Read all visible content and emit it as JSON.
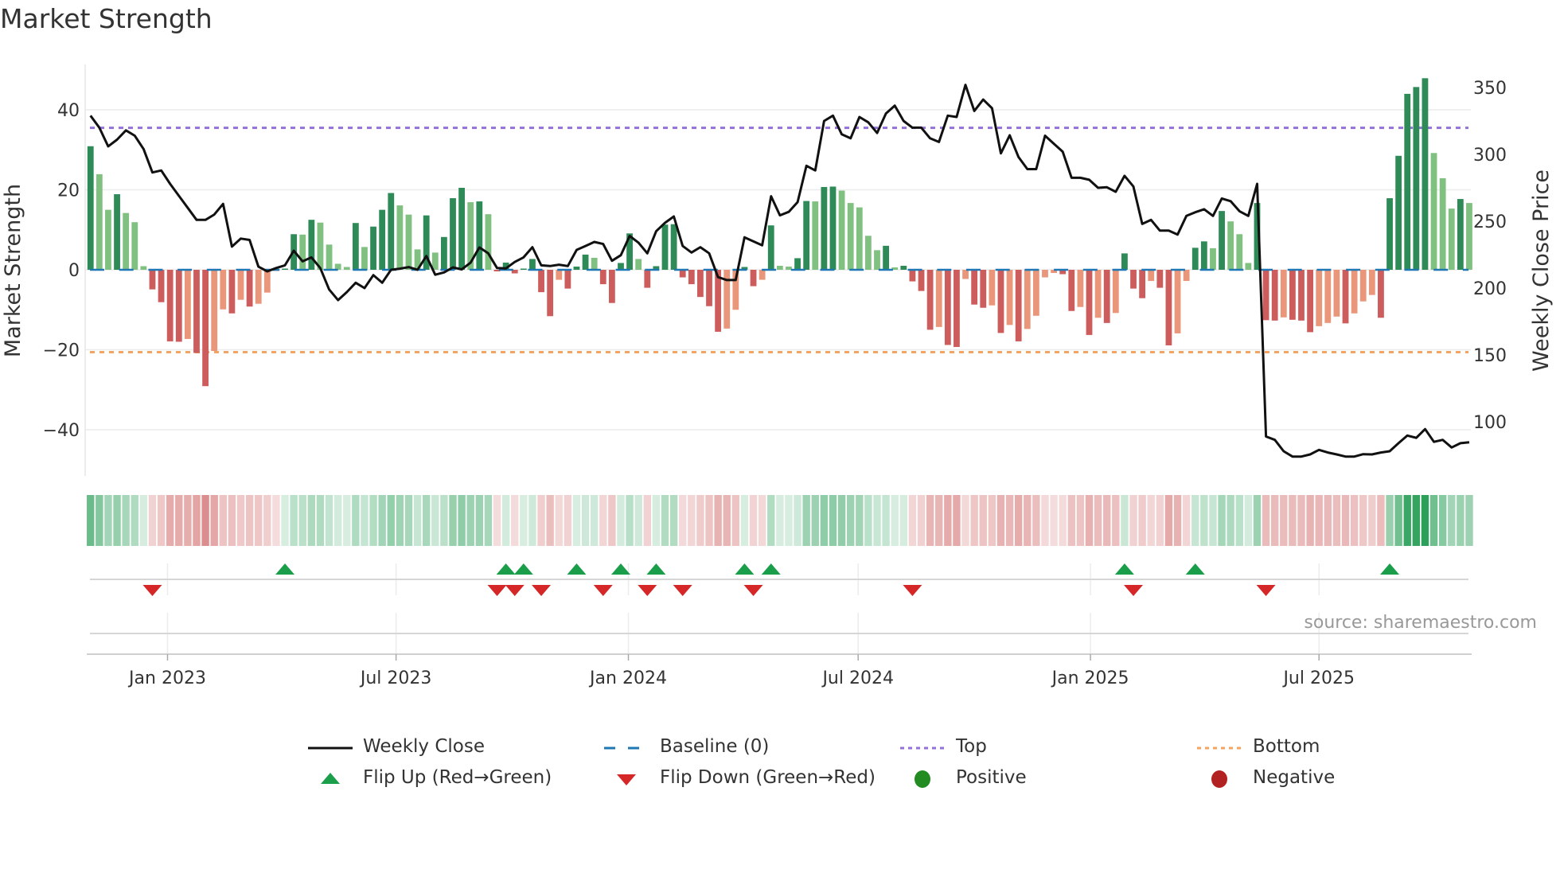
{
  "title": "Market Strength",
  "source": "source: sharemaestro.com",
  "colors": {
    "bar_up_strong": "#2e8b57",
    "bar_up_weak": "#80c080",
    "bar_down_strong": "#cd5c5c",
    "bar_down_weak": "#e9967a",
    "close_line": "#111111",
    "baseline": "#1f77b4",
    "top": "#9370db",
    "bottom": "#f4a460",
    "flip_up": "#1a9e4a",
    "flip_down": "#d62728",
    "positive": "#228b22",
    "negative": "#b22222"
  },
  "legend": [
    {
      "label": "Weekly Close",
      "icon": "solid-line"
    },
    {
      "label": "Baseline (0)",
      "icon": "dashed-line"
    },
    {
      "label": "Top",
      "icon": "dotted-line"
    },
    {
      "label": "Bottom",
      "icon": "dotted-line"
    },
    {
      "label": "Flip Up (Red→Green)",
      "icon": "triangle-up"
    },
    {
      "label": "Flip Down (Green→Red)",
      "icon": "triangle-down"
    },
    {
      "label": "Positive",
      "icon": "circle"
    },
    {
      "label": "Negative",
      "icon": "circle"
    }
  ],
  "chart_data": {
    "type": "bar+line",
    "title": "Market Strength",
    "ylabel": "Market Strength",
    "y2label": "Weekly Close Price",
    "ylim": [
      -51,
      52
    ],
    "y2lim": [
      60,
      367
    ],
    "yticks": [
      -40,
      -20,
      0,
      20,
      40
    ],
    "y2ticks": [
      100,
      150,
      200,
      250,
      300,
      350
    ],
    "xticks": [
      {
        "date": "2023-01-01",
        "label": "Jan 2023"
      },
      {
        "date": "2023-07-01",
        "label": "Jul 2023"
      },
      {
        "date": "2024-01-01",
        "label": "Jan 2024"
      },
      {
        "date": "2024-07-01",
        "label": "Jul 2024"
      },
      {
        "date": "2025-01-01",
        "label": "Jan 2025"
      },
      {
        "date": "2025-07-01",
        "label": "Jul 2025"
      }
    ],
    "grid": true,
    "legend_position": "bottom",
    "start_date": "2022-11-01",
    "interval_days": 7,
    "top_level": 35.5,
    "bottom_level": -20.6,
    "baseline": 0,
    "strength": [
      30.9,
      23.9,
      15,
      18.9,
      14.2,
      11.9,
      0.9,
      -4.9,
      -8.1,
      -17.9,
      -18,
      -17.3,
      -20.8,
      -29.1,
      -20.3,
      -9.9,
      -10.9,
      -7.5,
      -9.2,
      -8.5,
      -5.7,
      -0.3,
      0.3,
      8.9,
      8.8,
      12.5,
      11.8,
      6.3,
      1.5,
      0.7,
      11.7,
      5.7,
      10.8,
      15,
      19.2,
      16.1,
      13.8,
      5.1,
      13.6,
      4.3,
      8.2,
      17.9,
      20.5,
      16.9,
      17.1,
      13.9,
      -0.4,
      1.8,
      -0.9,
      0.3,
      2.7,
      -5.6,
      -11.6,
      -2.5,
      -4.7,
      0.8,
      3.8,
      3,
      -3.6,
      -8.3,
      1.7,
      9.1,
      2.7,
      -4.5,
      0.9,
      11.3,
      11.4,
      -1.9,
      -3.6,
      -6.8,
      -9.1,
      -15.5,
      -14.7,
      -10,
      0.7,
      -4.1,
      -2.5,
      11.1,
      1,
      0.8,
      2.9,
      17.2,
      17.1,
      20.7,
      20.8,
      19.8,
      16.7,
      15.6,
      8.5,
      4.9,
      6,
      0.6,
      1,
      -2.9,
      -5.3,
      -15,
      -14.3,
      -18.8,
      -19.3,
      -2.3,
      -8.7,
      -9.5,
      -8.9,
      -15.8,
      -13.8,
      -17.9,
      -14.8,
      -11.5,
      -1.9,
      -0.8,
      -1.1,
      -10.3,
      -9.3,
      -16.3,
      -12,
      -13.3,
      -10.8,
      4.1,
      -4.7,
      -7.1,
      -2.8,
      -4.5,
      -18.9,
      -15.9,
      -2.8,
      5.5,
      7.1,
      5.4,
      14.7,
      12.1,
      8.9,
      1.7,
      16.7,
      -12.6,
      -12.7,
      -11.9,
      -12.5,
      -12.7,
      -15.6,
      -14.1,
      -13.3,
      -11.7,
      -13.4,
      -10.9,
      -7.9,
      -6.3,
      -12,
      17.9,
      28.5,
      44,
      45.7,
      47.9,
      29.2,
      22.9,
      15.3,
      17.7,
      16.7
    ],
    "weekly_close": [
      329,
      320,
      306,
      311,
      318,
      314,
      304,
      286.5,
      288,
      278,
      269,
      260,
      251,
      251,
      255,
      263,
      231,
      237,
      236,
      216,
      212.5,
      215,
      217,
      228,
      220,
      223,
      215,
      199,
      191,
      197,
      204,
      200,
      209.7,
      204,
      213.7,
      214.5,
      215.7,
      213.7,
      224,
      210,
      211.7,
      215.5,
      214,
      219,
      230.4,
      226,
      215,
      214.7,
      219.5,
      223,
      230.6,
      217,
      216.5,
      217.5,
      216.5,
      228.6,
      231.5,
      234.5,
      233,
      220.4,
      224.6,
      239,
      234,
      226,
      242.5,
      248.8,
      253.6,
      231.5,
      226.6,
      230.6,
      226,
      208.2,
      206,
      206,
      238,
      235,
      232,
      268.7,
      254.4,
      257,
      264.3,
      291.5,
      288,
      325,
      329,
      315,
      312,
      328,
      324,
      316,
      330.6,
      336.5,
      325,
      320,
      320,
      312,
      309.3,
      329,
      328,
      352,
      332.5,
      341,
      334.5,
      300.8,
      314.3,
      298,
      289,
      289,
      314,
      308,
      302,
      282.5,
      282.5,
      281,
      275,
      275.4,
      272,
      284,
      276,
      248,
      251,
      243,
      243,
      240,
      254,
      256.7,
      259,
      254,
      267,
      265,
      257.5,
      254,
      278,
      89,
      86.5,
      78,
      74,
      74,
      75.6,
      79,
      77,
      75.6,
      74,
      74,
      75.8,
      75.6,
      77,
      78,
      84,
      89.7,
      88,
      94.5,
      85,
      86.5,
      80.8,
      84,
      84.7
    ]
  }
}
